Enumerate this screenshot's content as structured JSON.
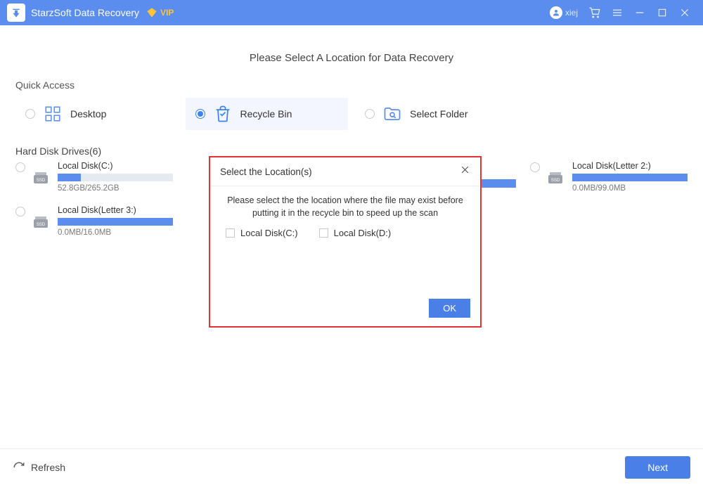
{
  "titlebar": {
    "app_name": "StarzSoft Data Recovery",
    "vip_label": "VIP",
    "user_name": "xiej"
  },
  "page": {
    "header": "Please Select A Location for Data Recovery",
    "quick_access_title": "Quick Access",
    "drives_title": "Hard Disk Drives(6)"
  },
  "quick_access": {
    "desktop_label": "Desktop",
    "recycle_label": "Recycle Bin",
    "folder_label": "Select Folder"
  },
  "drives": {
    "c": {
      "name": "Local Disk(C:)",
      "size": "52.8GB/265.2GB",
      "pct": 20
    },
    "letter2": {
      "name": "Local Disk(Letter 2:)",
      "size": "0.0MB/99.0MB",
      "pct": 100
    },
    "letter3": {
      "name": "Local Disk(Letter 3:)",
      "size": "0.0MB/16.0MB",
      "pct": 100
    }
  },
  "modal": {
    "title": "Select the Location(s)",
    "message": "Please select the the location where the file may exist before putting it in the recycle bin to speed up the scan",
    "opt_c": "Local Disk(C:)",
    "opt_d": "Local Disk(D:)",
    "ok": "OK"
  },
  "footer": {
    "refresh": "Refresh",
    "next": "Next"
  }
}
